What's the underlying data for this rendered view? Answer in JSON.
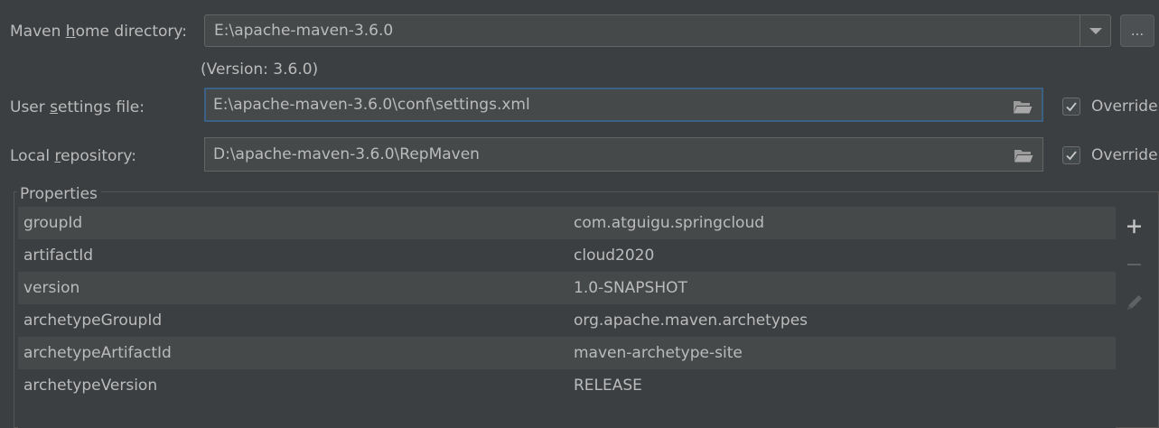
{
  "maven_home": {
    "label_before": "Maven ",
    "label_mnemonic": "h",
    "label_after": "ome directory:",
    "value": "E:\\apache-maven-3.6.0",
    "browse_label": "...",
    "version_text": "(Version: 3.6.0)"
  },
  "user_settings": {
    "label_before": "User ",
    "label_mnemonic": "s",
    "label_after": "ettings file:",
    "value": "E:\\apache-maven-3.6.0\\conf\\settings.xml",
    "override_label": "Override",
    "override_checked": true
  },
  "local_repo": {
    "label_before": "Local ",
    "label_mnemonic": "r",
    "label_after": "epository:",
    "value": "D:\\apache-maven-3.6.0\\RepMaven",
    "override_label": "Override",
    "override_checked": true
  },
  "properties": {
    "title": "Properties",
    "rows": [
      {
        "key": "groupId",
        "value": "com.atguigu.springcloud"
      },
      {
        "key": "artifactId",
        "value": "cloud2020"
      },
      {
        "key": "version",
        "value": "1.0-SNAPSHOT"
      },
      {
        "key": "archetypeGroupId",
        "value": "org.apache.maven.archetypes"
      },
      {
        "key": "archetypeArtifactId",
        "value": "maven-archetype-site"
      },
      {
        "key": "archetypeVersion",
        "value": "RELEASE"
      }
    ],
    "toolbar_icons": [
      "add-icon",
      "remove-icon",
      "edit-icon"
    ]
  },
  "colors": {
    "background": "#3c3f41",
    "field_bg": "#45494a",
    "focus_border": "#3d6185",
    "text": "#bbbbbb"
  }
}
